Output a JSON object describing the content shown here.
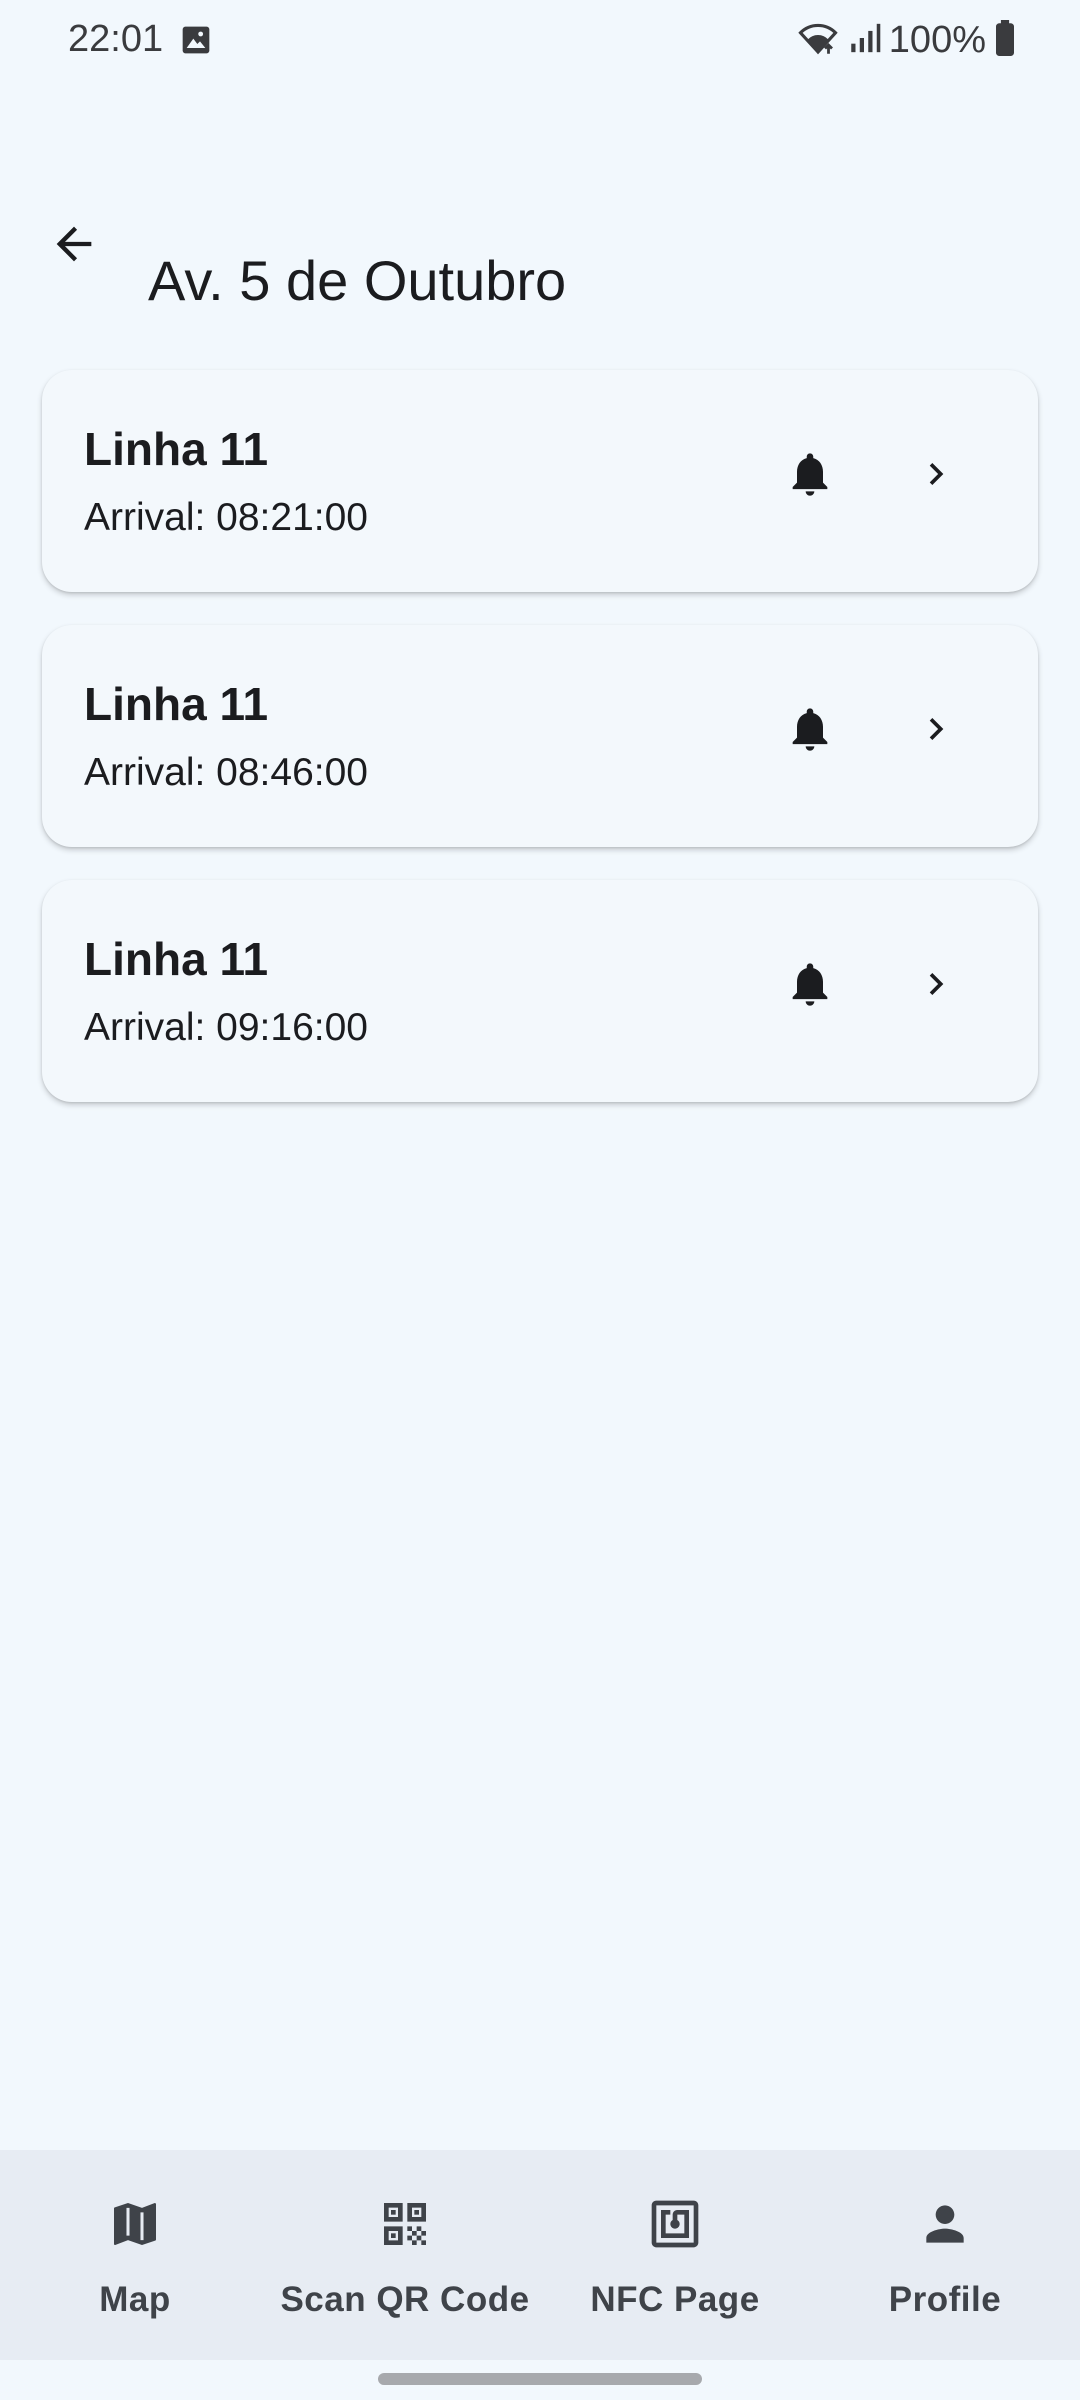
{
  "status_bar": {
    "time": "22:01",
    "battery": "100%",
    "icons": [
      "gallery-icon",
      "wifi-icon",
      "signal-icon",
      "battery-icon"
    ]
  },
  "app_bar": {
    "back_icon": "arrow-back-icon",
    "title": "Av. 5 de Outubro"
  },
  "arrivals": [
    {
      "title": "Linha 11",
      "subtitle": "Arrival: 08:21:00"
    },
    {
      "title": "Linha 11",
      "subtitle": "Arrival: 08:46:00"
    },
    {
      "title": "Linha 11",
      "subtitle": "Arrival: 09:16:00"
    }
  ],
  "bottom_nav": {
    "items": [
      {
        "label": "Map",
        "icon": "map-icon"
      },
      {
        "label": "Scan QR Code",
        "icon": "qr-code-icon"
      },
      {
        "label": "NFC Page",
        "icon": "nfc-icon"
      },
      {
        "label": "Profile",
        "icon": "person-icon"
      }
    ]
  },
  "colors": {
    "background": "#f2f8fd",
    "card": "#f3f8fc",
    "nav_background": "#e7ecf3",
    "text": "#1b1c1f",
    "nav_text": "#3f4349"
  }
}
